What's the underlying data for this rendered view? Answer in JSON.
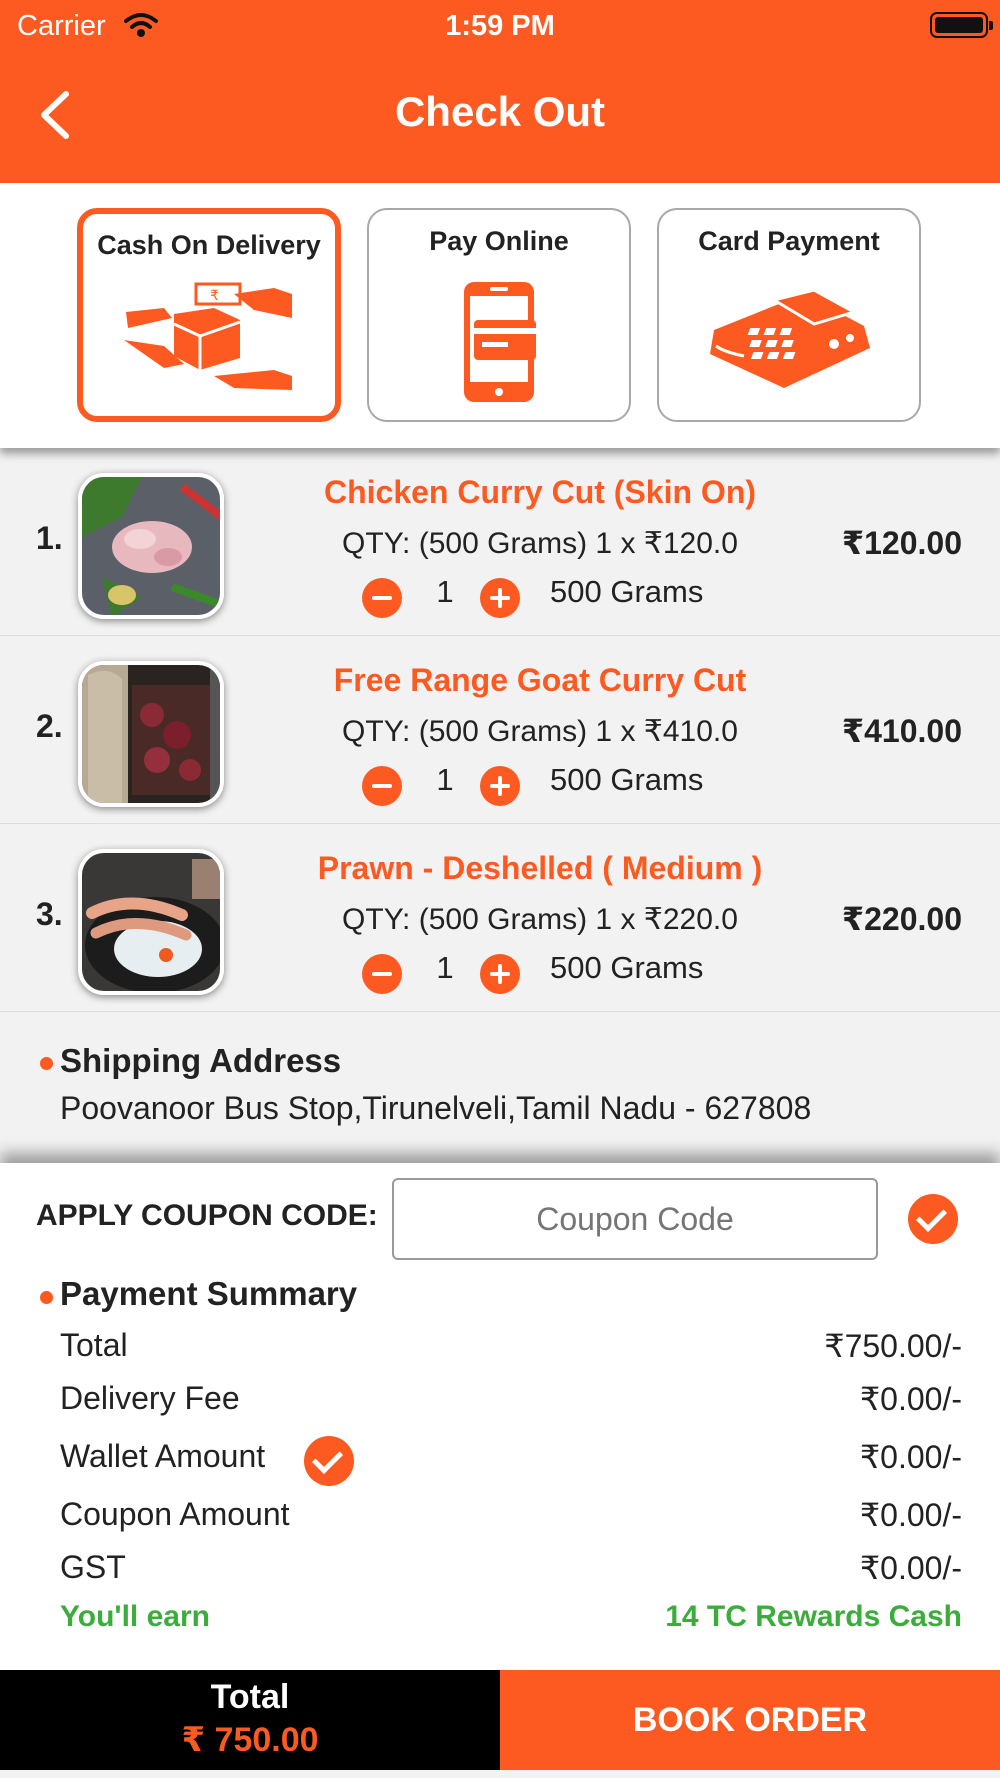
{
  "status_bar": {
    "carrier": "Carrier",
    "time": "1:59 PM"
  },
  "header": {
    "title": "Check Out",
    "back_icon": "chevron-left-icon"
  },
  "payment_methods": [
    {
      "label": "Cash On Delivery",
      "icon": "cash-delivery-icon",
      "selected": true
    },
    {
      "label": "Pay Online",
      "icon": "mobile-payment-icon",
      "selected": false
    },
    {
      "label": "Card Payment",
      "icon": "card-machine-icon",
      "selected": false
    }
  ],
  "items": [
    {
      "index": "1.",
      "name": "Chicken Curry Cut (Skin On)",
      "qty_text": "QTY: (500 Grams) 1 x ₹120.0",
      "quantity": "1",
      "unit": "500 Grams",
      "price": "₹120.00"
    },
    {
      "index": "2.",
      "name": "Free Range Goat Curry Cut",
      "qty_text": "QTY: (500 Grams) 1 x ₹410.0",
      "quantity": "1",
      "unit": "500 Grams",
      "price": "₹410.00"
    },
    {
      "index": "3.",
      "name": "Prawn - Deshelled  ( Medium )",
      "qty_text": "QTY: (500 Grams) 1 x ₹220.0",
      "quantity": "1",
      "unit": "500 Grams",
      "price": "₹220.00"
    }
  ],
  "shipping": {
    "title": "Shipping Address",
    "address": "Poovanoor Bus Stop,Tirunelveli,Tamil Nadu - 627808"
  },
  "coupon": {
    "label": "APPLY COUPON CODE:",
    "placeholder": "Coupon Code",
    "value": ""
  },
  "summary": {
    "title": "Payment Summary",
    "total_label": "Total",
    "total_value": "₹750.00/-",
    "delivery_label": "Delivery Fee",
    "delivery_value": "₹0.00/-",
    "wallet_label": "Wallet Amount",
    "wallet_value": "₹0.00/-",
    "coupon_label": "Coupon Amount",
    "coupon_value": "₹0.00/-",
    "gst_label": "GST",
    "gst_value": "₹0.00/-",
    "earn_label": "You'll earn",
    "earn_value": "14 TC Rewards Cash"
  },
  "footer": {
    "total_label": "Total",
    "total_value": "₹ 750.00",
    "book_label": "BOOK ORDER"
  },
  "colors": {
    "accent": "#fd5a22",
    "earn": "#3cac3c",
    "footer_dark": "#000000"
  }
}
